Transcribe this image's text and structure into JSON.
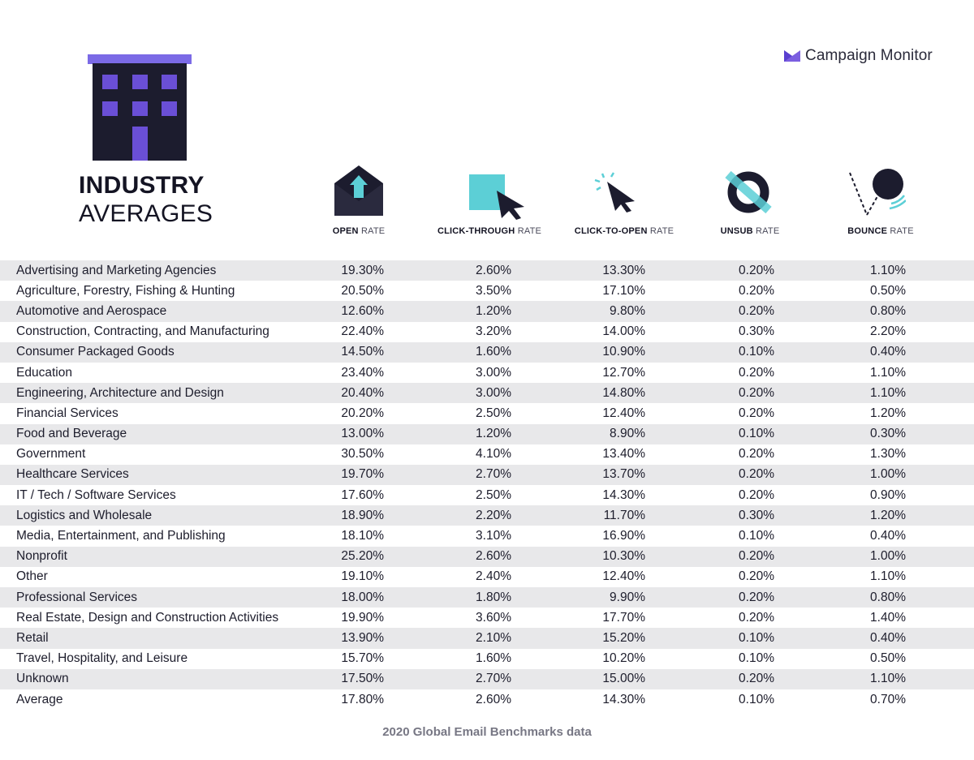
{
  "title": {
    "line1": "INDUSTRY",
    "line2": "AVERAGES"
  },
  "brand": {
    "name": "Campaign Monitor",
    "color": "#7b5ee0"
  },
  "colors": {
    "purple": "#6a4fd6",
    "dark": "#1c1c2e",
    "teal": "#5ccfd6",
    "row_shade": "#e8e8ea"
  },
  "metrics": [
    {
      "bold": "OPEN",
      "light": "RATE",
      "icon": "envelope-icon"
    },
    {
      "bold": "CLICK-THROUGH",
      "light": "RATE",
      "icon": "cursor-square-icon"
    },
    {
      "bold": "CLICK-TO-OPEN",
      "light": "RATE",
      "icon": "cursor-click-icon"
    },
    {
      "bold": "UNSUB",
      "light": "RATE",
      "icon": "unsubscribe-icon"
    },
    {
      "bold": "BOUNCE",
      "light": "RATE",
      "icon": "bounce-ball-icon"
    }
  ],
  "rows": [
    {
      "name": "Advertising and Marketing Agencies",
      "open": "19.30%",
      "ctr": "2.60%",
      "cto": "13.30%",
      "unsub": "0.20%",
      "bounce": "1.10%"
    },
    {
      "name": "Agriculture, Forestry, Fishing & Hunting",
      "open": "20.50%",
      "ctr": "3.50%",
      "cto": "17.10%",
      "unsub": "0.20%",
      "bounce": "0.50%"
    },
    {
      "name": "Automotive and Aerospace",
      "open": "12.60%",
      "ctr": "1.20%",
      "cto": "9.80%",
      "unsub": "0.20%",
      "bounce": "0.80%"
    },
    {
      "name": "Construction, Contracting, and Manufacturing",
      "open": "22.40%",
      "ctr": "3.20%",
      "cto": "14.00%",
      "unsub": "0.30%",
      "bounce": "2.20%"
    },
    {
      "name": "Consumer Packaged Goods",
      "open": "14.50%",
      "ctr": "1.60%",
      "cto": "10.90%",
      "unsub": "0.10%",
      "bounce": "0.40%"
    },
    {
      "name": "Education",
      "open": "23.40%",
      "ctr": "3.00%",
      "cto": "12.70%",
      "unsub": "0.20%",
      "bounce": "1.10%"
    },
    {
      "name": "Engineering, Architecture and Design",
      "open": "20.40%",
      "ctr": "3.00%",
      "cto": "14.80%",
      "unsub": "0.20%",
      "bounce": "1.10%"
    },
    {
      "name": "Financial Services",
      "open": "20.20%",
      "ctr": "2.50%",
      "cto": "12.40%",
      "unsub": "0.20%",
      "bounce": "1.20%"
    },
    {
      "name": "Food and Beverage",
      "open": "13.00%",
      "ctr": "1.20%",
      "cto": "8.90%",
      "unsub": "0.10%",
      "bounce": "0.30%"
    },
    {
      "name": "Government",
      "open": "30.50%",
      "ctr": "4.10%",
      "cto": "13.40%",
      "unsub": "0.20%",
      "bounce": "1.30%"
    },
    {
      "name": "Healthcare Services",
      "open": "19.70%",
      "ctr": "2.70%",
      "cto": "13.70%",
      "unsub": "0.20%",
      "bounce": "1.00%"
    },
    {
      "name": "IT / Tech / Software Services",
      "open": "17.60%",
      "ctr": "2.50%",
      "cto": "14.30%",
      "unsub": "0.20%",
      "bounce": "0.90%"
    },
    {
      "name": "Logistics and Wholesale",
      "open": "18.90%",
      "ctr": "2.20%",
      "cto": "11.70%",
      "unsub": "0.30%",
      "bounce": "1.20%"
    },
    {
      "name": "Media, Entertainment, and Publishing",
      "open": "18.10%",
      "ctr": "3.10%",
      "cto": "16.90%",
      "unsub": "0.10%",
      "bounce": "0.40%"
    },
    {
      "name": "Nonprofit",
      "open": "25.20%",
      "ctr": "2.60%",
      "cto": "10.30%",
      "unsub": "0.20%",
      "bounce": "1.00%"
    },
    {
      "name": "Other",
      "open": "19.10%",
      "ctr": "2.40%",
      "cto": "12.40%",
      "unsub": "0.20%",
      "bounce": "1.10%"
    },
    {
      "name": "Professional Services",
      "open": "18.00%",
      "ctr": "1.80%",
      "cto": "9.90%",
      "unsub": "0.20%",
      "bounce": "0.80%"
    },
    {
      "name": "Real Estate, Design and Construction Activities",
      "open": "19.90%",
      "ctr": "3.60%",
      "cto": "17.70%",
      "unsub": "0.20%",
      "bounce": "1.40%"
    },
    {
      "name": "Retail",
      "open": "13.90%",
      "ctr": "2.10%",
      "cto": "15.20%",
      "unsub": "0.10%",
      "bounce": "0.40%"
    },
    {
      "name": "Travel, Hospitality, and Leisure",
      "open": "15.70%",
      "ctr": "1.60%",
      "cto": "10.20%",
      "unsub": "0.10%",
      "bounce": "0.50%"
    },
    {
      "name": "Unknown",
      "open": "17.50%",
      "ctr": "2.70%",
      "cto": "15.00%",
      "unsub": "0.20%",
      "bounce": "1.10%"
    },
    {
      "name": "Average",
      "open": "17.80%",
      "ctr": "2.60%",
      "cto": "14.30%",
      "unsub": "0.10%",
      "bounce": "0.70%"
    }
  ],
  "footer": "2020 Global Email Benchmarks data"
}
